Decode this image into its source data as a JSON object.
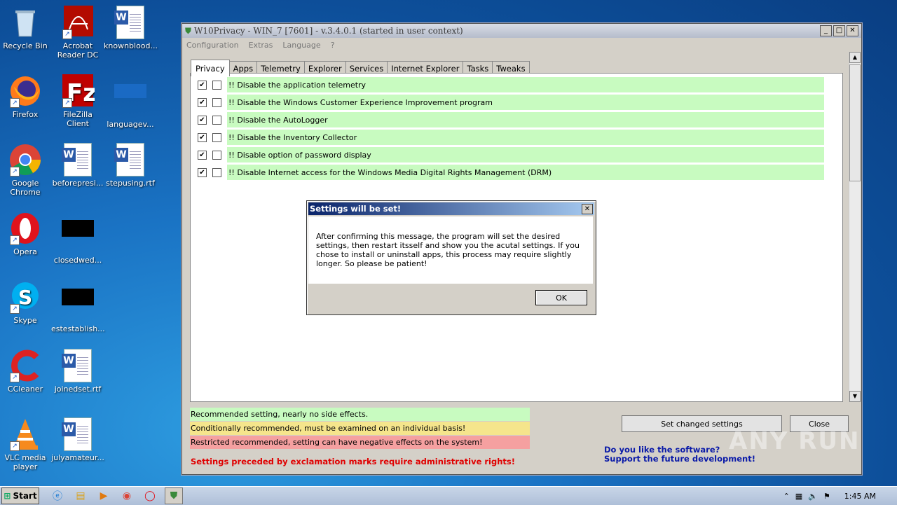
{
  "desktop": {
    "icons": [
      {
        "label": "Recycle Bin",
        "icon": "recycle-bin-icon"
      },
      {
        "label": "Acrobat Reader DC",
        "icon": "acrobat-icon"
      },
      {
        "label": "knownblood...",
        "icon": "word-doc-icon"
      },
      {
        "label": "Firefox",
        "icon": "firefox-icon"
      },
      {
        "label": "FileZilla Client",
        "icon": "filezilla-icon"
      },
      {
        "label": "languagev...",
        "icon": "file-icon"
      },
      {
        "label": "Google Chrome",
        "icon": "chrome-icon"
      },
      {
        "label": "beforepresi...",
        "icon": "word-doc-icon"
      },
      {
        "label": "stepusing.rtf",
        "icon": "word-doc-icon"
      },
      {
        "label": "Opera",
        "icon": "opera-icon"
      },
      {
        "label": "closedwed...",
        "icon": "black-file-icon"
      },
      {
        "label": "Skype",
        "icon": "skype-icon"
      },
      {
        "label": "estestablish...",
        "icon": "black-file-icon"
      },
      {
        "label": "CCleaner",
        "icon": "ccleaner-icon"
      },
      {
        "label": "joinedset.rtf",
        "icon": "word-doc-icon"
      },
      {
        "label": "VLC media player",
        "icon": "vlc-icon"
      },
      {
        "label": "julyamateur...",
        "icon": "word-doc-icon"
      }
    ]
  },
  "window": {
    "title": "W10Privacy - WIN_7 [7601]  - v.3.4.0.1 (started in user context)",
    "menu": [
      "Configuration",
      "Extras",
      "Language",
      "?"
    ],
    "tabs": [
      "Privacy",
      "Apps",
      "Telemetry",
      "Explorer",
      "Services",
      "Internet Explorer",
      "Tasks",
      "Tweaks"
    ],
    "active_tab": "Privacy",
    "settings": [
      {
        "label": "!! Disable the application telemetry",
        "checked": true
      },
      {
        "label": "!! Disable the Windows Customer Experience Improvement program",
        "checked": true
      },
      {
        "label": "!! Disable the AutoLogger",
        "checked": true
      },
      {
        "label": "!! Disable the Inventory Collector",
        "checked": true
      },
      {
        "label": "!! Disable option of password display",
        "checked": true
      },
      {
        "label": "!! Disable Internet access for the Windows Media Digital Rights Management (DRM)",
        "checked": true
      }
    ],
    "legend": [
      {
        "text": "Recommended setting, nearly no side effects.",
        "color": "#c8fbc0"
      },
      {
        "text": "Conditionally recommended, must be examined on an individual basis!",
        "color": "#f5e58c"
      },
      {
        "text": "Restricted recommended, setting can have negative effects on the system!",
        "color": "#f5a0a0"
      }
    ],
    "admin_warning": "Settings preceded by exclamation marks require administrative rights!",
    "set_button": "Set changed settings",
    "close_button": "Close",
    "support_line1": "Do you like the software?",
    "support_line2": "Support the future development!"
  },
  "dialog": {
    "title": "Settings will be set!",
    "message": "After confirming this message, the program will set the desired settings, then restart itsself and show you the acutal settings. If you chose to install or uninstall apps, this process may require slightly longer. So please be patient!",
    "ok": "OK"
  },
  "taskbar": {
    "start": "Start",
    "time": "1:45 AM"
  },
  "watermark": "ANY RUN"
}
